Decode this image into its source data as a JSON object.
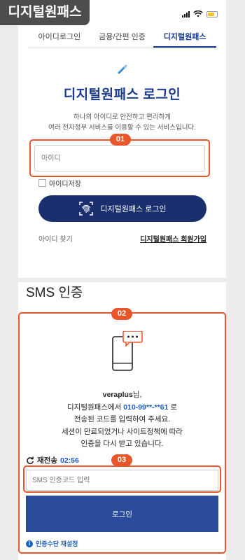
{
  "corner_label": "디지털원패스",
  "tabs": [
    {
      "label": "아이디로그인"
    },
    {
      "label": "금융/간편 인증"
    },
    {
      "label": "디지털원패스"
    }
  ],
  "login": {
    "title": "디지털원패스 로그인",
    "desc_line1": "하나의 아이디로 안전하고 편리하게",
    "desc_line2": "여러 전자정부 서비스를 이용할 수 있는 서비스입니다.",
    "id_placeholder": "아이디",
    "save_id_label": "아이디저장",
    "button_label": "디지털원패스 로그인",
    "find_id": "아이디 찾기",
    "signup": "디지털원패스 회원가입"
  },
  "badges": {
    "b1": "01",
    "b2": "02",
    "b3": "03"
  },
  "sms": {
    "title": "SMS 인증",
    "user": "veraplus",
    "user_suffix": "님,",
    "line2_pre": "디지털원패스에서 ",
    "phone": "010-99**-**61",
    "line2_post": " 로",
    "line3": "전송된 코드를 입력하여 주세요.",
    "line4": "세션이 만료되었거나 사이트정책에 따라",
    "line5": "인증을 다시 받고 있습니다.",
    "resend_label": "재전송",
    "timer": "02:56",
    "code_placeholder": "SMS 인증코드 입력",
    "login_button": "로그인",
    "reset_label": "인증수단 재설정",
    "info_symbol": "i"
  },
  "colors": {
    "accent": "#1a3a8f",
    "highlight": "#e8562a",
    "link": "#1a5fc1"
  }
}
